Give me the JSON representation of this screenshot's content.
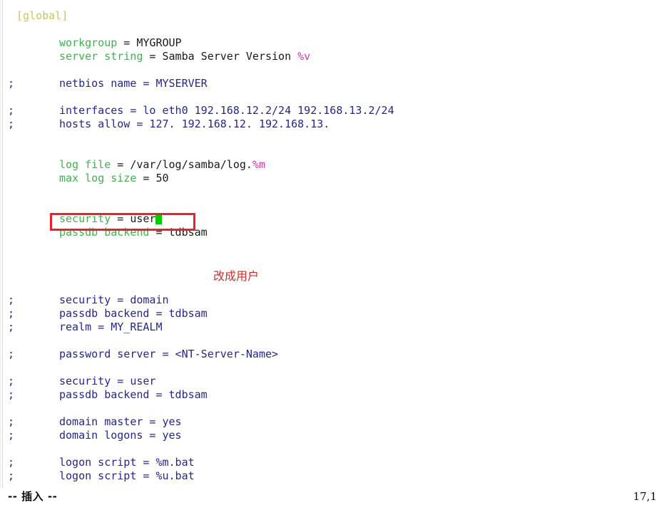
{
  "app": {
    "kind": "vim-terminal-editor",
    "file_type": "samba-smb-conf",
    "background": "#ffffff"
  },
  "colors": {
    "section": "#c9c75a",
    "key": "#3fb34f",
    "value": "#1a1a1a",
    "macro": "#d838a8",
    "comment": "#26268c",
    "cursor": "#00cc00",
    "annotation": "#d62b2b",
    "highlight_box": "#e8242a"
  },
  "editor": {
    "lines": [
      {
        "gutter": "",
        "indent": false,
        "segments": [
          {
            "text": "[global]",
            "style": "sec"
          }
        ]
      },
      {
        "gutter": "",
        "indent": false,
        "segments": []
      },
      {
        "gutter": "",
        "indent": true,
        "segments": [
          {
            "text": "workgroup",
            "style": "key"
          },
          {
            "text": " = ",
            "style": "punct"
          },
          {
            "text": "MYGROUP",
            "style": "val"
          }
        ]
      },
      {
        "gutter": "",
        "indent": true,
        "segments": [
          {
            "text": "server string",
            "style": "key"
          },
          {
            "text": " = ",
            "style": "punct"
          },
          {
            "text": "Samba Server Version ",
            "style": "val"
          },
          {
            "text": "%v",
            "style": "var"
          }
        ]
      },
      {
        "gutter": "",
        "indent": false,
        "segments": []
      },
      {
        "gutter": ";",
        "indent": true,
        "segments": [
          {
            "text": "netbios name = MYSERVER",
            "style": "cmt"
          }
        ]
      },
      {
        "gutter": "",
        "indent": false,
        "segments": []
      },
      {
        "gutter": ";",
        "indent": true,
        "segments": [
          {
            "text": "interfaces = lo eth0 192.168.12.2/24 192.168.13.2/24",
            "style": "cmt"
          }
        ]
      },
      {
        "gutter": ";",
        "indent": true,
        "segments": [
          {
            "text": "hosts allow = 127. 192.168.12. 192.168.13.",
            "style": "cmt"
          }
        ]
      },
      {
        "gutter": "",
        "indent": false,
        "segments": []
      },
      {
        "gutter": "",
        "indent": false,
        "segments": []
      },
      {
        "gutter": "",
        "indent": true,
        "segments": [
          {
            "text": "log file",
            "style": "key"
          },
          {
            "text": " = ",
            "style": "punct"
          },
          {
            "text": "/var/log/samba/log.",
            "style": "val"
          },
          {
            "text": "%m",
            "style": "var"
          }
        ]
      },
      {
        "gutter": "",
        "indent": true,
        "segments": [
          {
            "text": "max log size",
            "style": "key"
          },
          {
            "text": " = ",
            "style": "punct"
          },
          {
            "text": "50",
            "style": "val"
          }
        ]
      },
      {
        "gutter": "",
        "indent": false,
        "segments": []
      },
      {
        "gutter": "",
        "indent": false,
        "segments": []
      },
      {
        "gutter": "",
        "indent": true,
        "segments": [
          {
            "text": "security",
            "style": "key"
          },
          {
            "text": " = ",
            "style": "punct"
          },
          {
            "text": "user",
            "style": "val"
          },
          {
            "text": "",
            "style": "cursor"
          }
        ]
      },
      {
        "gutter": "",
        "indent": true,
        "segments": [
          {
            "text": "passdb backend",
            "style": "key"
          },
          {
            "text": " = ",
            "style": "punct"
          },
          {
            "text": "tdbsam",
            "style": "val"
          }
        ]
      },
      {
        "gutter": "",
        "indent": false,
        "segments": []
      },
      {
        "gutter": "",
        "indent": false,
        "segments": []
      },
      {
        "gutter": "",
        "indent": false,
        "segments": []
      },
      {
        "gutter": "",
        "indent": false,
        "segments": []
      },
      {
        "gutter": ";",
        "indent": true,
        "segments": [
          {
            "text": "security = domain",
            "style": "cmt"
          }
        ]
      },
      {
        "gutter": ";",
        "indent": true,
        "segments": [
          {
            "text": "passdb backend = tdbsam",
            "style": "cmt"
          }
        ]
      },
      {
        "gutter": ";",
        "indent": true,
        "segments": [
          {
            "text": "realm = MY_REALM",
            "style": "cmt"
          }
        ]
      },
      {
        "gutter": "",
        "indent": false,
        "segments": []
      },
      {
        "gutter": ";",
        "indent": true,
        "segments": [
          {
            "text": "password server = <NT-Server-Name>",
            "style": "cmt"
          }
        ]
      },
      {
        "gutter": "",
        "indent": false,
        "segments": []
      },
      {
        "gutter": ";",
        "indent": true,
        "segments": [
          {
            "text": "security = user",
            "style": "cmt"
          }
        ]
      },
      {
        "gutter": ";",
        "indent": true,
        "segments": [
          {
            "text": "passdb backend = tdbsam",
            "style": "cmt"
          }
        ]
      },
      {
        "gutter": "",
        "indent": false,
        "segments": []
      },
      {
        "gutter": ";",
        "indent": true,
        "segments": [
          {
            "text": "domain master = yes",
            "style": "cmt"
          }
        ]
      },
      {
        "gutter": ";",
        "indent": true,
        "segments": [
          {
            "text": "domain logons = yes",
            "style": "cmt"
          }
        ]
      },
      {
        "gutter": "",
        "indent": false,
        "segments": []
      },
      {
        "gutter": ";",
        "indent": true,
        "segments": [
          {
            "text": "logon script = %m.bat",
            "style": "cmt"
          }
        ]
      },
      {
        "gutter": ";",
        "indent": true,
        "segments": [
          {
            "text": "logon script = %u.bat",
            "style": "cmt"
          }
        ]
      }
    ]
  },
  "annotation": {
    "text": "改成用户"
  },
  "statusbar": {
    "mode": "-- 插入 --",
    "position": "17,1"
  }
}
